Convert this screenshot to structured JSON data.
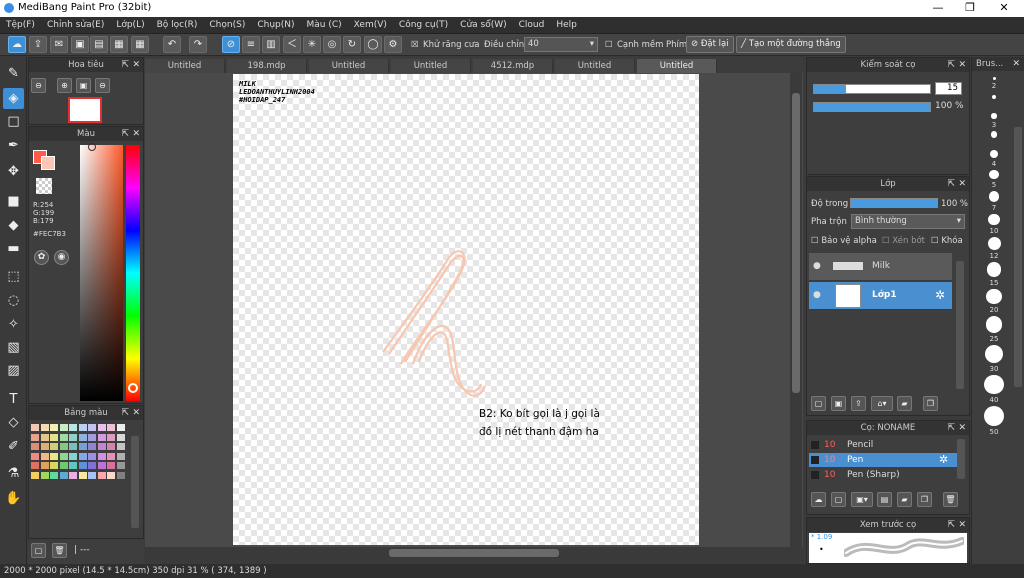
{
  "window": {
    "title": "MediBang Paint Pro (32bit)",
    "minimize": "—",
    "maximize": "❐",
    "close": "✕"
  },
  "menu": [
    "Tệp(F)",
    "Chỉnh sửa(E)",
    "Lớp(L)",
    "Bộ lọc(R)",
    "Chọn(S)",
    "Chụp(N)",
    "Màu (C)",
    "Xem(V)",
    "Công cụ(T)",
    "Cửa sổ(W)",
    "Cloud",
    "Help"
  ],
  "toolbar": {
    "antialias_label": "Khử răng cưa",
    "adjust_label": "Điều chỉnh",
    "adjust_value": "40",
    "edge_label": "Cạnh mềm",
    "key_label": "Phím",
    "reset_label": "Đặt lại",
    "straight_label": "Tạo một đường thẳng"
  },
  "tabs": [
    "Untitled",
    "198.mdp",
    "Untitled",
    "Untitled",
    "4512.mdp",
    "Untitled",
    "Untitled"
  ],
  "navigator": {
    "title": "Hoa tiêu"
  },
  "color_panel": {
    "title": "Màu",
    "r": "R:254",
    "g": "G:199",
    "b": "B:179",
    "hex": "#FEC7B3",
    "accent": "#FEC7B3"
  },
  "palette": {
    "title": "Bảng màu",
    "colors": [
      "#f3c9b5",
      "#f3dcb2",
      "#f0f0b8",
      "#c9ecc5",
      "#b8e6e0",
      "#bad2ee",
      "#c5c2ee",
      "#e6c2ec",
      "#f0c2d6",
      "#eeeeee",
      "#e8a38f",
      "#e8c48f",
      "#e3e38f",
      "#9fdba0",
      "#8fd2ca",
      "#8fb2e0",
      "#a39ce0",
      "#d29ce0",
      "#e09cbc",
      "#d8d8d8",
      "#d98e7a",
      "#d9b07a",
      "#cfcf7a",
      "#82c884",
      "#7ac0b8",
      "#7a9fd2",
      "#8e86d2",
      "#c086d2",
      "#d286aa",
      "#c4c4c4",
      "#f08a82",
      "#f0b882",
      "#e8e882",
      "#8ed88e",
      "#82d8d0",
      "#82a8e8",
      "#9a90e8",
      "#d090e8",
      "#e890b8",
      "#b0b0b0",
      "#e07060",
      "#e0a060",
      "#d8d860",
      "#70c870",
      "#60c8c0",
      "#6090d8",
      "#8070d8",
      "#c070d8",
      "#d870a0",
      "#989898",
      "#f0d060",
      "#a0d860",
      "#60d8a0",
      "#60a8d8",
      "#e8b0e0",
      "#f8e8a0",
      "#a8c0f8",
      "#f8a8a8",
      "#fcd8c8",
      "#808080"
    ]
  },
  "brush_control": {
    "title": "Kiểm soát cọ",
    "size_value": "15",
    "opacity_value": "100 %",
    "size_fraction": 0.28,
    "opacity_fraction": 1.0
  },
  "layer_panel": {
    "title": "Lớp",
    "opacity_label": "Độ trong",
    "opacity_value": "100 %",
    "blend_label": "Pha trộn",
    "blend_value": "Bình thường",
    "protect_alpha": "Bảo vệ alpha",
    "clipping": "Xén bớt",
    "lock": "Khóa",
    "layers": [
      {
        "name": "Milk",
        "selected": false
      },
      {
        "name": "Lớp1",
        "selected": true
      }
    ]
  },
  "brush_list": {
    "title": "Cọ: NONAME",
    "items": [
      {
        "size": "10",
        "name": "Pencil"
      },
      {
        "size": "10",
        "name": "Pen"
      },
      {
        "size": "10",
        "name": "Pen (Sharp)"
      }
    ]
  },
  "brush_preview": {
    "title": "Xem trước cọ",
    "size_text": "* 1.09"
  },
  "brush_sizes": {
    "title": "Brus...",
    "sizes": [
      "2",
      "",
      "3",
      "",
      "4",
      "5",
      "7",
      "10",
      "12",
      "15",
      "20",
      "25",
      "30",
      "40",
      "50"
    ]
  },
  "canvas": {
    "watermark": [
      "MILK",
      "LEDOANTHUYLINH2004",
      "#HOIDAP_247"
    ],
    "note_lines": [
      "B2: Ko bít gọi là j gọi là",
      "đồ lị nét thanh đậm ha"
    ],
    "stroke_color": "#f7c7b2"
  },
  "status": "2000 * 2000 pixel   (14.5 * 14.5cm)   350 dpi   31 %   ( 374, 1389 )"
}
